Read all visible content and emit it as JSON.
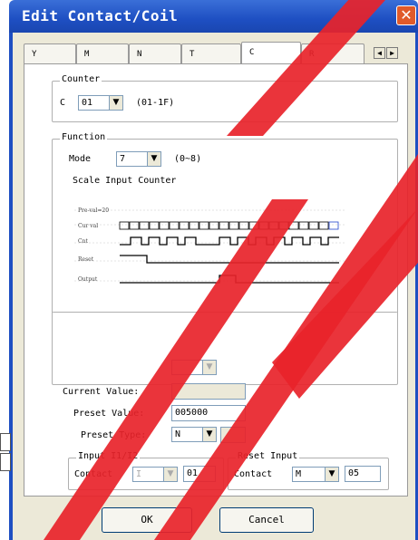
{
  "window": {
    "title": "Edit Contact/Coil"
  },
  "tabs": [
    "Y",
    "M",
    "N",
    "T",
    "C",
    "R"
  ],
  "active_tab": "C",
  "counter": {
    "group_label": "Counter",
    "prefix": "C",
    "value": "01",
    "range": "(01-1F)"
  },
  "function": {
    "group_label": "Function",
    "mode_label": "Mode",
    "mode_value": "7",
    "mode_range": "(0~8)",
    "description": "Scale Input Counter"
  },
  "timing": {
    "rows": [
      "Pre-val=20",
      "Cur val",
      "Cnt",
      "Reset",
      "Output"
    ]
  },
  "values": {
    "current_label": "Current Value:",
    "current_value": "",
    "preset_label": "Preset Value:",
    "preset_value": "005000",
    "preset_type_label": "Preset Type:",
    "preset_type_value": "N"
  },
  "input_group": {
    "label": "Input I1/I2",
    "contact_label": "Contact",
    "type_value": "I",
    "number_value": "01"
  },
  "reset_group": {
    "label": "Reset Input",
    "contact_label": "Contact",
    "type_value": "M",
    "number_value": "05"
  },
  "buttons": {
    "ok": "OK",
    "cancel": "Cancel"
  },
  "colors": {
    "title_bar": "#1e4fc2",
    "dialog_bg": "#ece9d8",
    "close_button": "#e05a2a",
    "watermark": "#e8232a"
  }
}
